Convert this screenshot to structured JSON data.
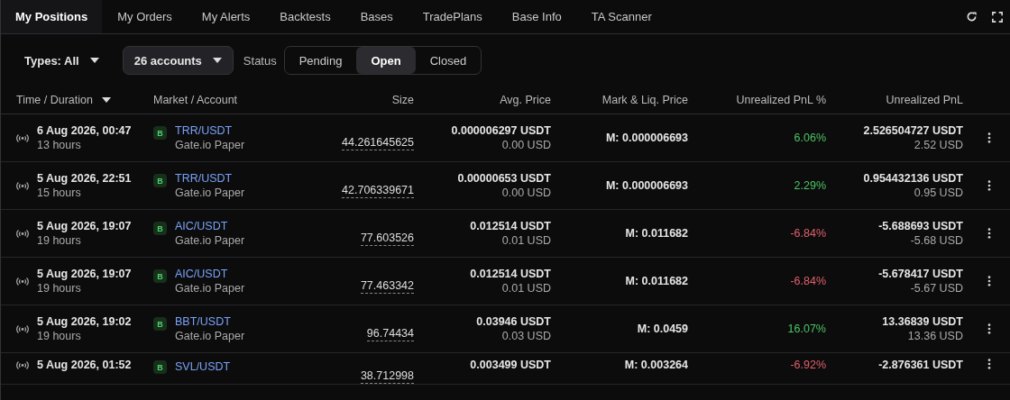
{
  "tabs": [
    {
      "label": "My Positions",
      "selected": true
    },
    {
      "label": "My Orders",
      "selected": false
    },
    {
      "label": "My Alerts",
      "selected": false
    },
    {
      "label": "Backtests",
      "selected": false
    },
    {
      "label": "Bases",
      "selected": false
    },
    {
      "label": "TradePlans",
      "selected": false
    },
    {
      "label": "Base Info",
      "selected": false
    },
    {
      "label": "TA Scanner",
      "selected": false
    }
  ],
  "filters": {
    "types": "Types: All",
    "accounts": "26 accounts",
    "status_label": "Status",
    "status_options": [
      {
        "label": "Pending",
        "selected": false
      },
      {
        "label": "Open",
        "selected": true
      },
      {
        "label": "Closed",
        "selected": false
      }
    ]
  },
  "table": {
    "columns": [
      {
        "label": "Time / Duration",
        "sorted": true
      },
      {
        "label": "Market / Account",
        "sorted": false
      },
      {
        "label": "Size",
        "sorted": false
      },
      {
        "label": "Avg. Price",
        "sorted": false
      },
      {
        "label": "Mark & Liq. Price",
        "sorted": false
      },
      {
        "label": "Unrealized PnL %",
        "sorted": false
      },
      {
        "label": "Unrealized PnL",
        "sorted": false
      }
    ],
    "rows": [
      {
        "time": "6 Aug 2026, 00:47",
        "duration": "13 hours",
        "side": "B",
        "market": "TRR/USDT",
        "account": "Gate.io Paper",
        "size": "44.261645625",
        "avg_price": "0.000006297 USDT",
        "avg_price_usd": "0.00 USD",
        "mark": "M: 0.000006693",
        "pnl_pct": "6.06%",
        "kind": "gain",
        "pnl": "2.526504727 USDT",
        "pnl_usd": "2.52 USD"
      },
      {
        "time": "5 Aug 2026, 22:51",
        "duration": "15 hours",
        "side": "B",
        "market": "TRR/USDT",
        "account": "Gate.io Paper",
        "size": "42.706339671",
        "avg_price": "0.00000653 USDT",
        "avg_price_usd": "0.00 USD",
        "mark": "M: 0.000006693",
        "pnl_pct": "2.29%",
        "kind": "gain",
        "pnl": "0.954432136 USDT",
        "pnl_usd": "0.95 USD"
      },
      {
        "time": "5 Aug 2026, 19:07",
        "duration": "19 hours",
        "side": "B",
        "market": "AIC/USDT",
        "account": "Gate.io Paper",
        "size": "77.603526",
        "avg_price": "0.012514 USDT",
        "avg_price_usd": "0.01 USD",
        "mark": "M: 0.011682",
        "pnl_pct": "-6.84%",
        "kind": "loss",
        "pnl": "-5.688693 USDT",
        "pnl_usd": "-5.68 USD"
      },
      {
        "time": "5 Aug 2026, 19:07",
        "duration": "19 hours",
        "side": "B",
        "market": "AIC/USDT",
        "account": "Gate.io Paper",
        "size": "77.463342",
        "avg_price": "0.012514 USDT",
        "avg_price_usd": "0.01 USD",
        "mark": "M: 0.011682",
        "pnl_pct": "-6.84%",
        "kind": "loss",
        "pnl": "-5.678417 USDT",
        "pnl_usd": "-5.67 USD"
      },
      {
        "time": "5 Aug 2026, 19:02",
        "duration": "19 hours",
        "side": "B",
        "market": "BBT/USDT",
        "account": "Gate.io Paper",
        "size": "96.74434",
        "avg_price": "0.03946 USDT",
        "avg_price_usd": "0.03 USD",
        "mark": "M: 0.0459",
        "pnl_pct": "16.07%",
        "kind": "gain",
        "pnl": "13.36839 USDT",
        "pnl_usd": "13.36 USD"
      },
      {
        "time": "5 Aug 2026, 01:52",
        "side": "B",
        "market": "SVL/USDT",
        "size": "38.712998",
        "avg_price": "0.003499 USDT",
        "mark": "M: 0.003264",
        "pnl_pct": "-6.92%",
        "kind": "loss",
        "pnl": "-2.876361 USDT"
      }
    ]
  }
}
